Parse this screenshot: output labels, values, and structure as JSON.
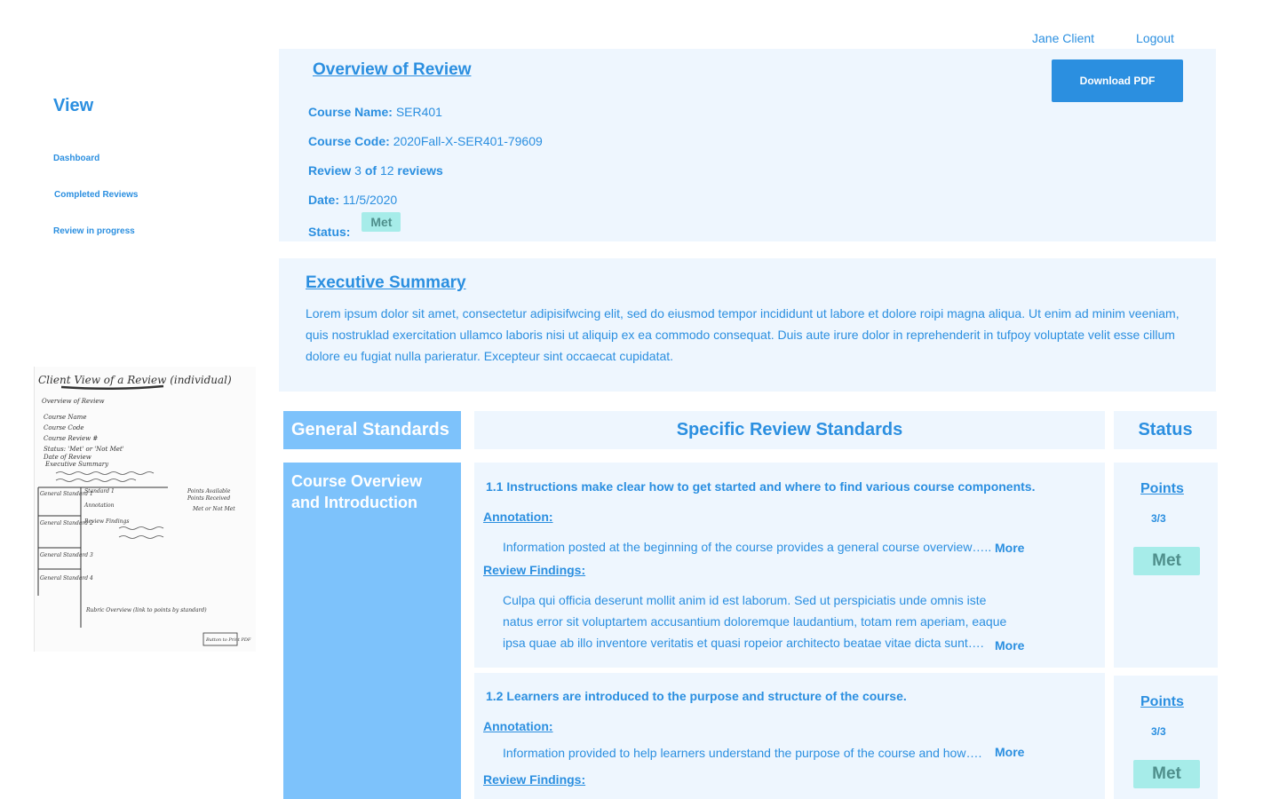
{
  "header": {
    "user_name": "Jane Client",
    "logout_label": "Logout"
  },
  "sidebar": {
    "title": "View",
    "items": [
      {
        "label": "Dashboard"
      },
      {
        "label": "Completed Reviews"
      },
      {
        "label": "Review in progress"
      }
    ]
  },
  "overview": {
    "heading": "Overview of Review",
    "download_label": "Download PDF",
    "course_name_label": "Course Name:",
    "course_name": "SER401",
    "course_code_label": "Course Code:",
    "course_code": "2020Fall-X-SER401-79609",
    "review_label": "Review",
    "review_number": "3",
    "review_of": "of",
    "review_total": "12",
    "reviews_word": "reviews",
    "date_label": "Date:",
    "date": "11/5/2020",
    "status_label": "Status:",
    "status": "Met"
  },
  "executive_summary": {
    "heading": "Executive Summary",
    "text": "Lorem ipsum dolor sit amet, consectetur adipisifwcing elit, sed do eiusmod tempor incididunt ut labore et dolore roipi magna aliqua. Ut enim ad minim veeniam, quis nostruklad exercitation ullamco laboris nisi ut aliquip ex ea commodo consequat. Duis aute irure dolor in reprehenderit in tufpoy voluptate velit esse cillum dolore eu fugiat nulla parieratur. Excepteur sint occaecat cupidatat."
  },
  "table": {
    "general_header": "General Standards",
    "specific_header": "Specific Review Standards",
    "status_header": "Status",
    "general_standard": "Course Overview and Introduction",
    "standards": [
      {
        "title": "1.1 Instructions make clear how to get started and where to find various course components.",
        "annotation_label": "Annotation:",
        "annotation": "Information posted at the beginning of the course provides a general course overview…..",
        "findings_label": "Review Findings:",
        "findings": "Culpa qui officia deserunt mollit anim id est laborum. Sed ut perspiciatis unde omnis iste natus error sit voluptartem accusantium doloremque laudantium, totam rem aperiam, eaque ipsa quae ab illo inventore veritatis et quasi ropeior architecto beatae vitae dicta sunt….",
        "more_label": "More",
        "points_label": "Points",
        "score": "3/3",
        "status": "Met"
      },
      {
        "title": "1.2 Learners are introduced to the purpose and structure of the course.",
        "annotation_label": "Annotation:",
        "annotation": "Information provided to help learners understand the purpose of the course and how….",
        "findings_label": "Review Findings:",
        "more_label": "More",
        "points_label": "Points",
        "score": "3/3",
        "status": "Met"
      }
    ]
  },
  "sketch": {
    "title": "Client View of a Review (individual)",
    "lines": [
      "Overview of Review",
      "Course Name",
      "Course Code",
      "Course Review #",
      "Status: 'Met' or 'Not Met'",
      "Date of Review",
      "Executive Summary"
    ],
    "standard_1": "Standard 1",
    "annotation": "Annotation",
    "review_findings": "Review Findings",
    "general_standard_2": "General Standard 2",
    "general_standard_3": "General Standard 3",
    "general_standard_4": "General Standard 4",
    "points_available": "Points Available",
    "points_received": "Points Received",
    "met_or_not_met": "Met or Not Met",
    "rubric_overview": "Rubric Overview (link to points by standard)",
    "button_label": "Button to Print PDF"
  }
}
